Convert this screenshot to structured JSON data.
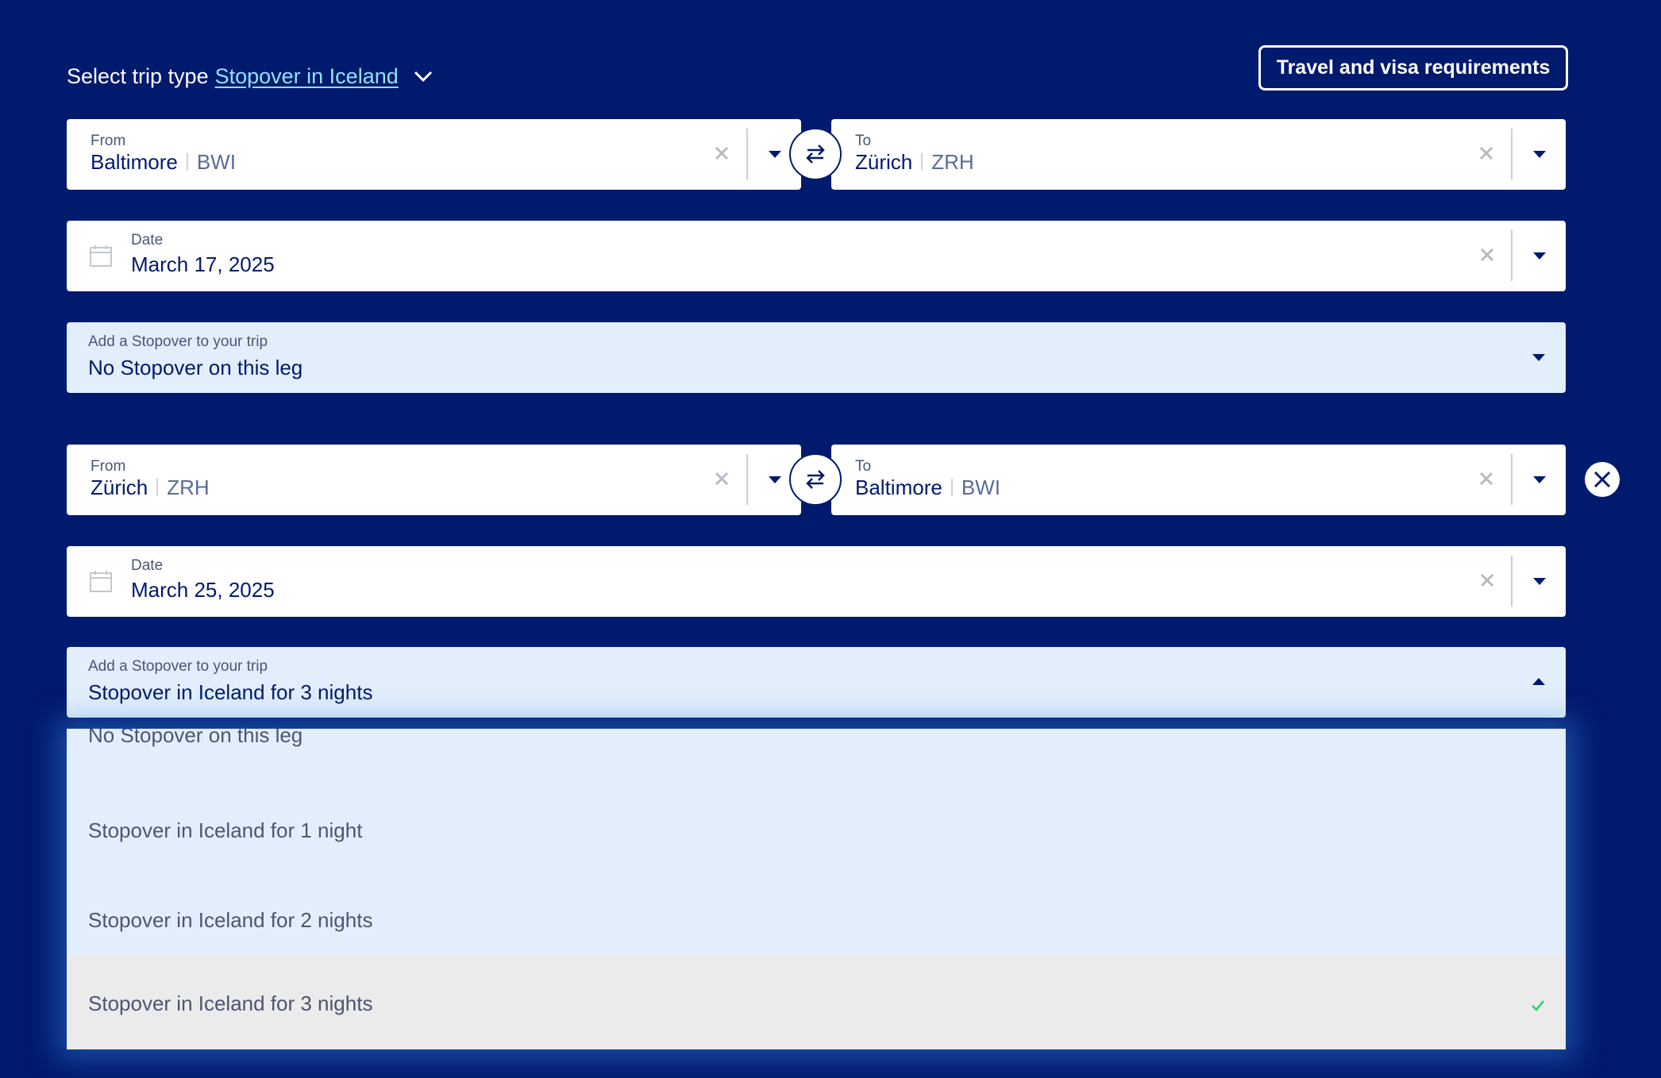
{
  "header": {
    "trip_type_label": "Select trip type",
    "trip_type_value": "Stopover in Iceland",
    "visa_button": "Travel and visa requirements"
  },
  "legs": [
    {
      "from": {
        "label": "From",
        "city": "Baltimore",
        "code": "BWI"
      },
      "to": {
        "label": "To",
        "city": "Zürich",
        "code": "ZRH"
      },
      "date": {
        "label": "Date",
        "value": "March 17, 2025"
      },
      "stopover": {
        "label": "Add a Stopover to your trip",
        "value": "No Stopover on this leg"
      }
    },
    {
      "from": {
        "label": "From",
        "city": "Zürich",
        "code": "ZRH"
      },
      "to": {
        "label": "To",
        "city": "Baltimore",
        "code": "BWI"
      },
      "date": {
        "label": "Date",
        "value": "March 25, 2025"
      },
      "stopover": {
        "label": "Add a Stopover to your trip",
        "value": "Stopover in Iceland for 3 nights"
      }
    }
  ],
  "stopover_options": [
    "No Stopover on this leg",
    "Stopover in Iceland for 1 night",
    "Stopover in Iceland for 2 nights",
    "Stopover in Iceland for 3 nights"
  ],
  "selected_option": "Stopover in Iceland for 3 nights",
  "colors": {
    "background": "#001a6e",
    "link": "#8fe3ff",
    "stopover_bg": "#e3eefc",
    "selected_bg": "#ebebec",
    "check": "#2ecc71"
  },
  "icons": [
    "chevron-down-icon",
    "clear-icon",
    "caret-down-icon",
    "caret-up-icon",
    "swap-icon",
    "calendar-icon",
    "close-icon",
    "check-icon"
  ]
}
